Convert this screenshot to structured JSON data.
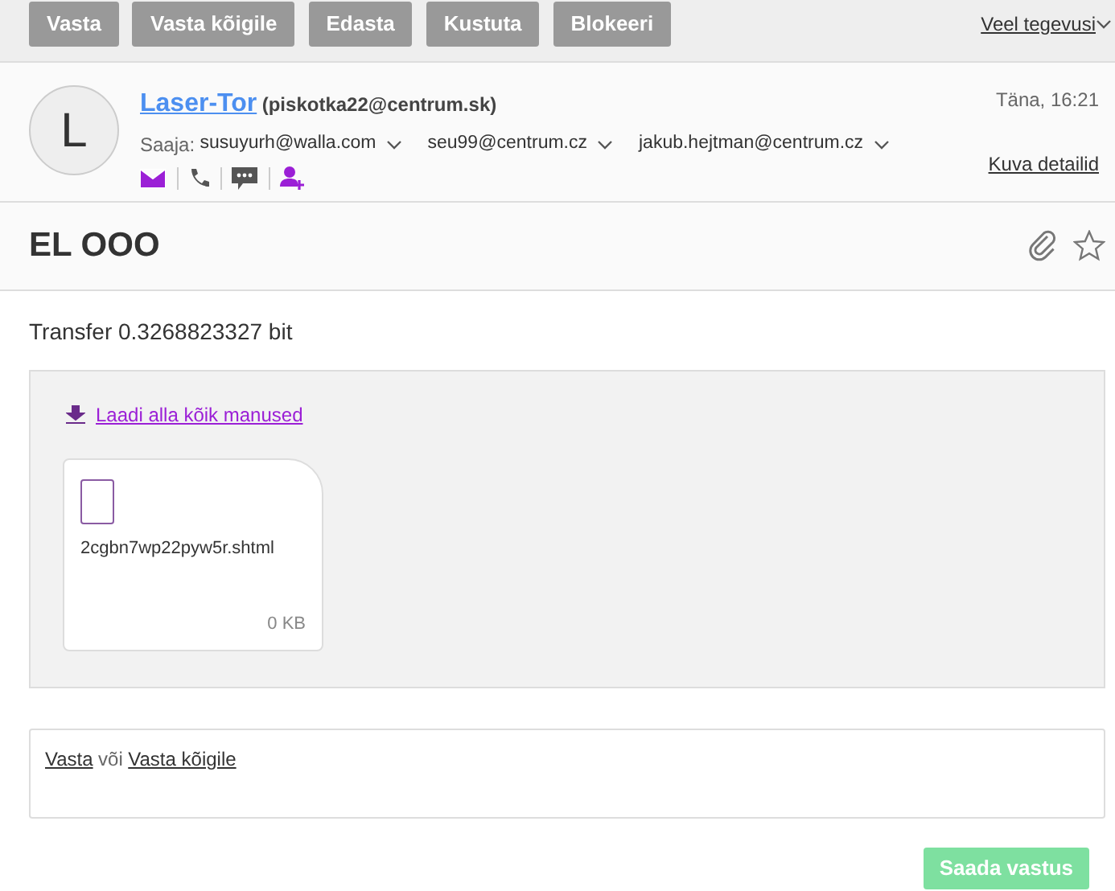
{
  "toolbar": {
    "buttons": [
      "Vasta",
      "Vasta kõigile",
      "Edasta",
      "Kustuta",
      "Blokeeri"
    ],
    "more": "Veel tegevusi"
  },
  "message": {
    "avatar": "L",
    "sender_name": "Laser-Tor",
    "sender_email": "(piskotka22@centrum.sk)",
    "date": "Täna, 16:21",
    "to_label": "Saaja:",
    "recipients": [
      "susuyurh@walla.com",
      "seu99@centrum.cz",
      "jakub.hejtman@centrum.cz"
    ],
    "details_link": "Kuva detailid",
    "subject": "EL OOO",
    "starred": false,
    "body": "Transfer 0.3268823327 bit"
  },
  "attachments": {
    "download_all": "Laadi alla kõik manused",
    "files": [
      {
        "name": "2cgbn7wp22pyw5r.shtml",
        "size": "0 KB"
      }
    ]
  },
  "reply": {
    "link_reply": "Vasta",
    "separator": "või",
    "link_reply_all": "Vasta kõigile",
    "send_button": "Saada vastus",
    "disabled": true
  }
}
